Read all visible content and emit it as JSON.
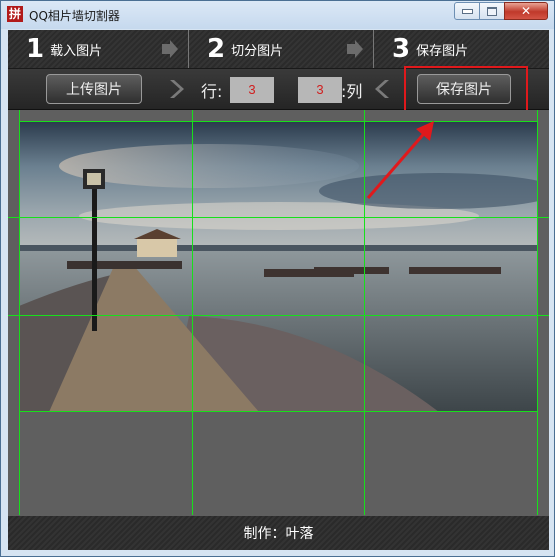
{
  "window": {
    "title": "QQ相片墙切割器",
    "app_icon_glyph": "拼"
  },
  "steps": [
    {
      "number": "1",
      "label": "载入图片"
    },
    {
      "number": "2",
      "label": "切分图片"
    },
    {
      "number": "3",
      "label": "保存图片"
    }
  ],
  "toolbar": {
    "upload_label": "上传图片",
    "rows_label": "行:",
    "rows_value": "3",
    "cols_value": "3",
    "cols_label": ":列",
    "save_label": "保存图片"
  },
  "grid": {
    "rows": 3,
    "cols": 3,
    "line_color": "#17e01b"
  },
  "annotation": {
    "color": "#e0191c"
  },
  "footer": {
    "credit": "制作：叶落"
  }
}
